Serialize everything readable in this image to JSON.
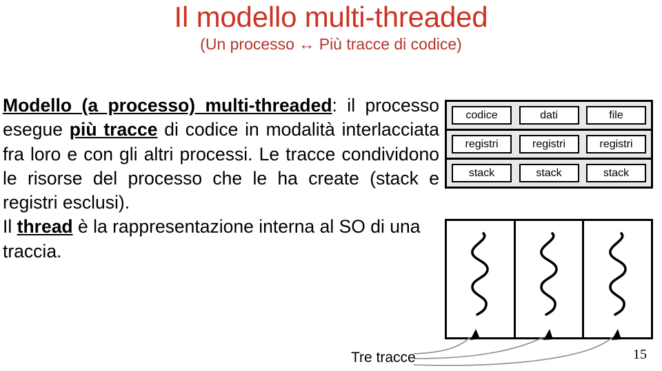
{
  "slide": {
    "title": "Il modello multi-threaded",
    "subtitle": "(Un processo ↔ Più tracce di codice)",
    "number": "15",
    "title_color": "#cc3322",
    "subtitle_color": "#b5332a"
  },
  "body": {
    "run1_bold": "Modello (a processo) multi-threaded",
    "run2": ": il processo esegue ",
    "run3_bold": "più tracce",
    "run4": " di codice in modalità interlacciata fra loro e con gli altri processi. Le tracce condividono le risorse del processo che le ha create (stack e registri esclusi).",
    "line_il": "Il ",
    "run5_bold": "thread",
    "run6": " è la rappresentazione interna al SO di una traccia."
  },
  "diagram": {
    "resource_rows": [
      {
        "row_name": "shared-resources-row",
        "cells": [
          "codice",
          "dati",
          "file"
        ]
      },
      {
        "row_name": "registers-row",
        "cells": [
          "registri",
          "registri",
          "registri"
        ]
      },
      {
        "row_name": "stacks-row",
        "cells": [
          "stack",
          "stack",
          "stack"
        ]
      }
    ],
    "thread_count": 3,
    "thread_icon": "squiggly-thread-icon",
    "caption": "Tre tracce",
    "connector_color": "#888888",
    "box_border_color": "#000000",
    "block_background": "#e8e8e8"
  }
}
